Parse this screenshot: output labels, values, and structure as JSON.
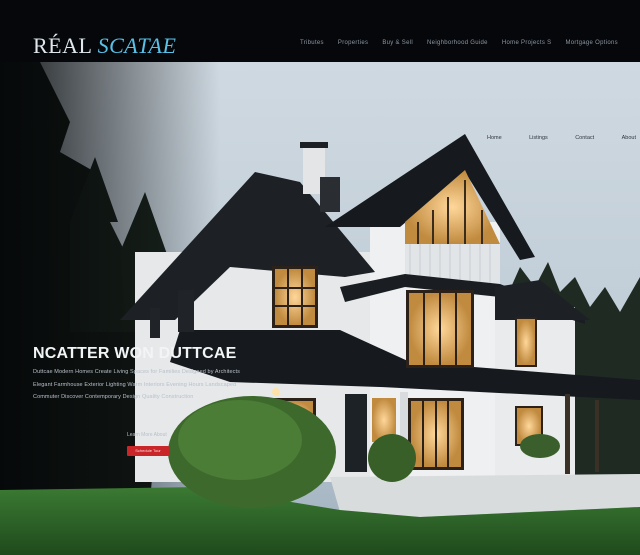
{
  "brand": {
    "word1": "RÉAL",
    "word2": "SCATAE"
  },
  "nav": {
    "items": [
      "Tributes",
      "Properties",
      "Buy & Sell",
      "Neighborhood Guide",
      "Home Projects S",
      "Mortgage Options"
    ]
  },
  "subnav": {
    "items": [
      "Home",
      "Listings",
      "Contact",
      "About"
    ]
  },
  "hero": {
    "title": "NCATTER WON DUTTCAE",
    "lines": [
      "Duttcae Modern Homes Create Living Spaces for Families Designed by Architects",
      "Elegant Farmhouse Exterior Lighting Warm Interiors Evening Hours Landscaped",
      "Commuter Discover Contemporary Design Quality Construction"
    ],
    "small_text": "Learn More About",
    "cta_label": "Schedule Tour"
  },
  "colors": {
    "topbar": "#05070a",
    "logo_primary": "#dfe7ee",
    "logo_accent": "#58c1e8",
    "cta": "#c9262a",
    "sky": "#c9d6df",
    "roof": "#1c1f24",
    "siding": "#eceef0",
    "lawn": "#2f6a2a"
  }
}
